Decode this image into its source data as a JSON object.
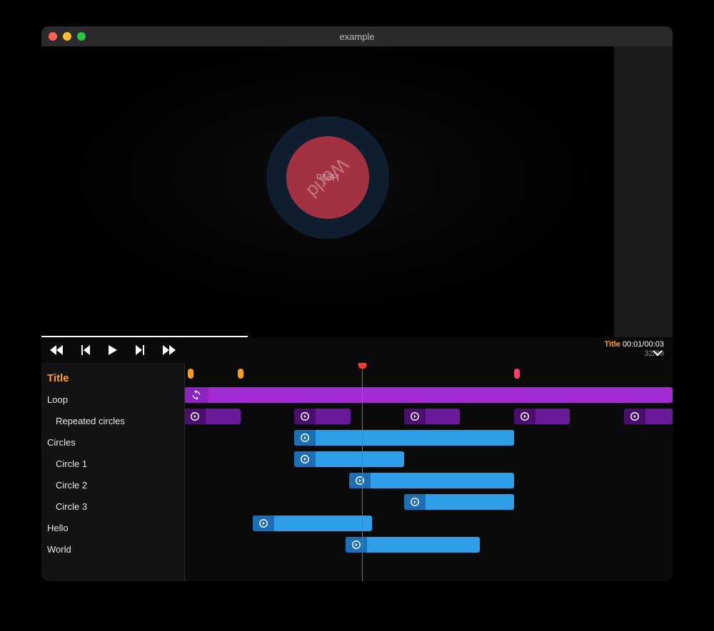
{
  "window": {
    "title": "example"
  },
  "preview": {
    "hello": "Hello",
    "world": "World"
  },
  "controls": {
    "title_label": "Title",
    "time": "00:01/00:03",
    "frames": "32/89"
  },
  "timeline": {
    "header": "Title",
    "playhead_pct": 36.4,
    "markers": [
      {
        "pct": 0.8,
        "kind": "orange"
      },
      {
        "pct": 11.0,
        "kind": "orange"
      },
      {
        "pct": 67.5,
        "kind": "pink"
      }
    ],
    "tracks": [
      {
        "label": "Loop",
        "indent": 0,
        "clips": [
          {
            "start": 0,
            "width": 100,
            "style": "loop",
            "icon": "loop"
          }
        ]
      },
      {
        "label": "Repeated circles",
        "indent": 1,
        "clips": [
          {
            "start": 0,
            "width": 11.5,
            "style": "darkpurple",
            "icon": "target"
          },
          {
            "start": 22.5,
            "width": 11.5,
            "style": "darkpurple",
            "icon": "target"
          },
          {
            "start": 45.0,
            "width": 11.5,
            "style": "darkpurple",
            "icon": "target"
          },
          {
            "start": 67.5,
            "width": 11.5,
            "style": "darkpurple",
            "icon": "target"
          },
          {
            "start": 90.0,
            "width": 10.0,
            "style": "darkpurple",
            "icon": "target"
          }
        ]
      },
      {
        "label": "Circles",
        "indent": 0,
        "clips": [
          {
            "start": 22.5,
            "width": 45.0,
            "style": "blue",
            "icon": "target"
          }
        ]
      },
      {
        "label": "Circle 1",
        "indent": 1,
        "clips": [
          {
            "start": 22.5,
            "width": 22.5,
            "style": "blue",
            "icon": "target"
          }
        ]
      },
      {
        "label": "Circle 2",
        "indent": 1,
        "clips": [
          {
            "start": 33.8,
            "width": 33.8,
            "style": "blue",
            "icon": "target"
          }
        ]
      },
      {
        "label": "Circle 3",
        "indent": 1,
        "clips": [
          {
            "start": 45.0,
            "width": 22.5,
            "style": "blue",
            "icon": "target"
          }
        ]
      },
      {
        "label": "Hello",
        "indent": 0,
        "clips": [
          {
            "start": 14.0,
            "width": 24.5,
            "style": "blue",
            "icon": "target"
          }
        ]
      },
      {
        "label": "World",
        "indent": 0,
        "clips": [
          {
            "start": 33.0,
            "width": 27.5,
            "style": "blue",
            "icon": "target"
          }
        ]
      }
    ]
  }
}
